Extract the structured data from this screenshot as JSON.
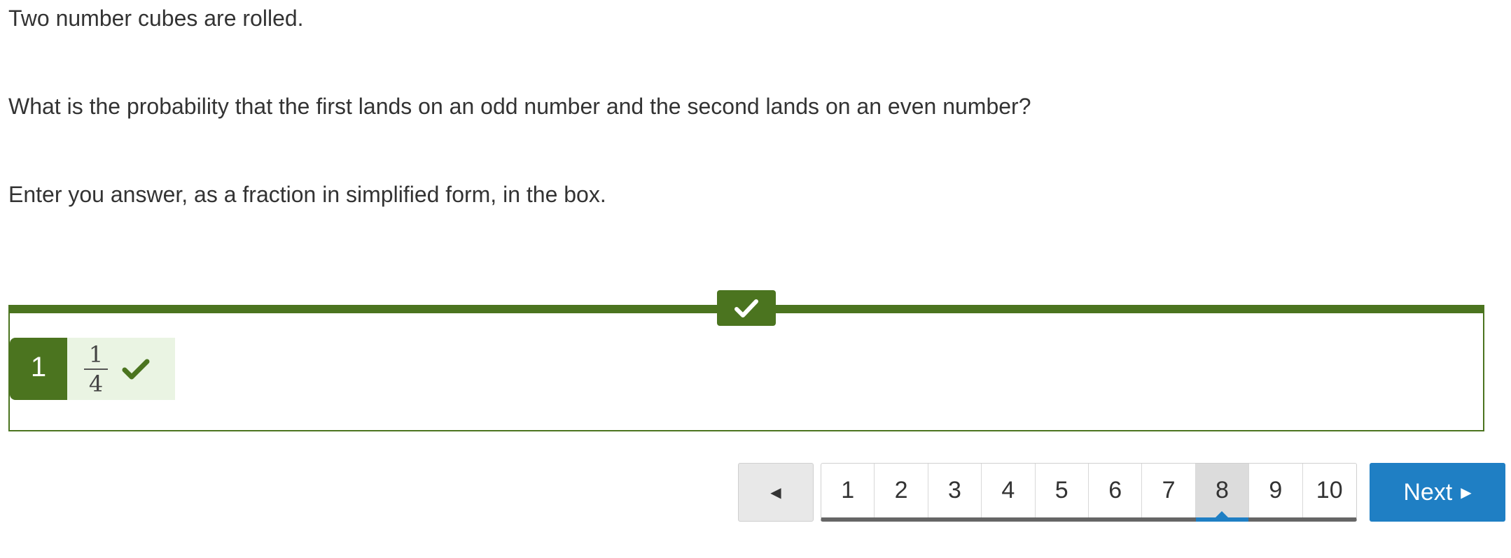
{
  "question": {
    "line1": "Two number cubes are rolled.",
    "line2": "What is the probability that the first lands on an odd number and the second lands on an even number?",
    "line3": "Enter you answer, as a fraction in simplified form, in the box."
  },
  "feedback": {
    "status_icon": "check-icon",
    "color": "#4b741f",
    "response": {
      "index": "1",
      "numerator": "1",
      "denominator": "4",
      "result_icon": "check-icon"
    }
  },
  "navigation": {
    "prev_icon": "◀",
    "pages": [
      "1",
      "2",
      "3",
      "4",
      "5",
      "6",
      "7",
      "8",
      "9",
      "10"
    ],
    "current_page": "8",
    "next_label": "Next",
    "next_icon": "▶",
    "accent": "#1f7fc4"
  }
}
